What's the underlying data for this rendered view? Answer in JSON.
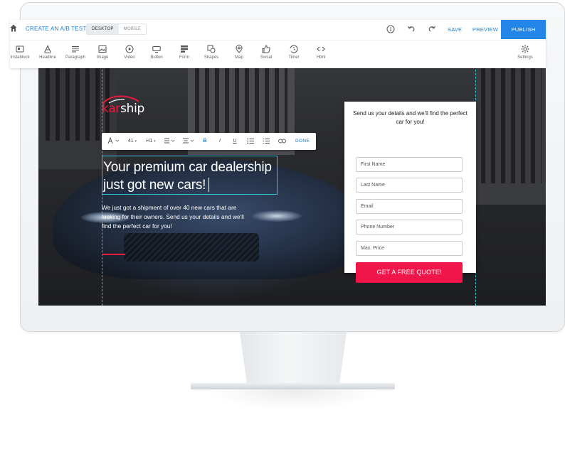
{
  "toolbar": {
    "title": "CREATE AN A/B TEST",
    "device_tabs": [
      "DESKTOP",
      "MOBILE"
    ],
    "save_label": "SAVE",
    "preview_label": "PREVIEW",
    "publish_label": "PUBLISH",
    "tools": [
      {
        "label": "Instablock",
        "icon": "instablock-icon"
      },
      {
        "label": "Headline",
        "icon": "headline-icon"
      },
      {
        "label": "Paragraph",
        "icon": "paragraph-icon"
      },
      {
        "label": "Image",
        "icon": "image-icon"
      },
      {
        "label": "Video",
        "icon": "video-icon"
      },
      {
        "label": "Button",
        "icon": "button-icon"
      },
      {
        "label": "Form",
        "icon": "form-icon"
      },
      {
        "label": "Shapes",
        "icon": "shapes-icon"
      },
      {
        "label": "Map",
        "icon": "map-icon"
      },
      {
        "label": "Social",
        "icon": "social-icon"
      },
      {
        "label": "Timer",
        "icon": "timer-icon"
      },
      {
        "label": "Html",
        "icon": "html-icon"
      }
    ],
    "settings_label": "Settings"
  },
  "text_toolbar": {
    "font_size": "41",
    "heading_level": "H1",
    "done_label": "DONE"
  },
  "page": {
    "logo_part1": "kar",
    "logo_part2": "ship",
    "headline_line1": "Your premium car dealership",
    "headline_line2": "just got new cars!",
    "subtext": "We just got a shipment of over 40 new cars that are looking for their owners. Send us your details and we'll find the perfect car for you!"
  },
  "form": {
    "heading": "Send us your details and we'll find the perfect car for you!",
    "fields": [
      "First Name",
      "Last Name",
      "Email",
      "Phone Number",
      "Max. Price"
    ],
    "submit_label": "GET A FREE QUOTE!"
  },
  "colors": {
    "accent_blue": "#2385e6",
    "brand_red": "#e8193c",
    "cta_red": "#f0164a",
    "guide_cyan": "#2ec4d6"
  }
}
